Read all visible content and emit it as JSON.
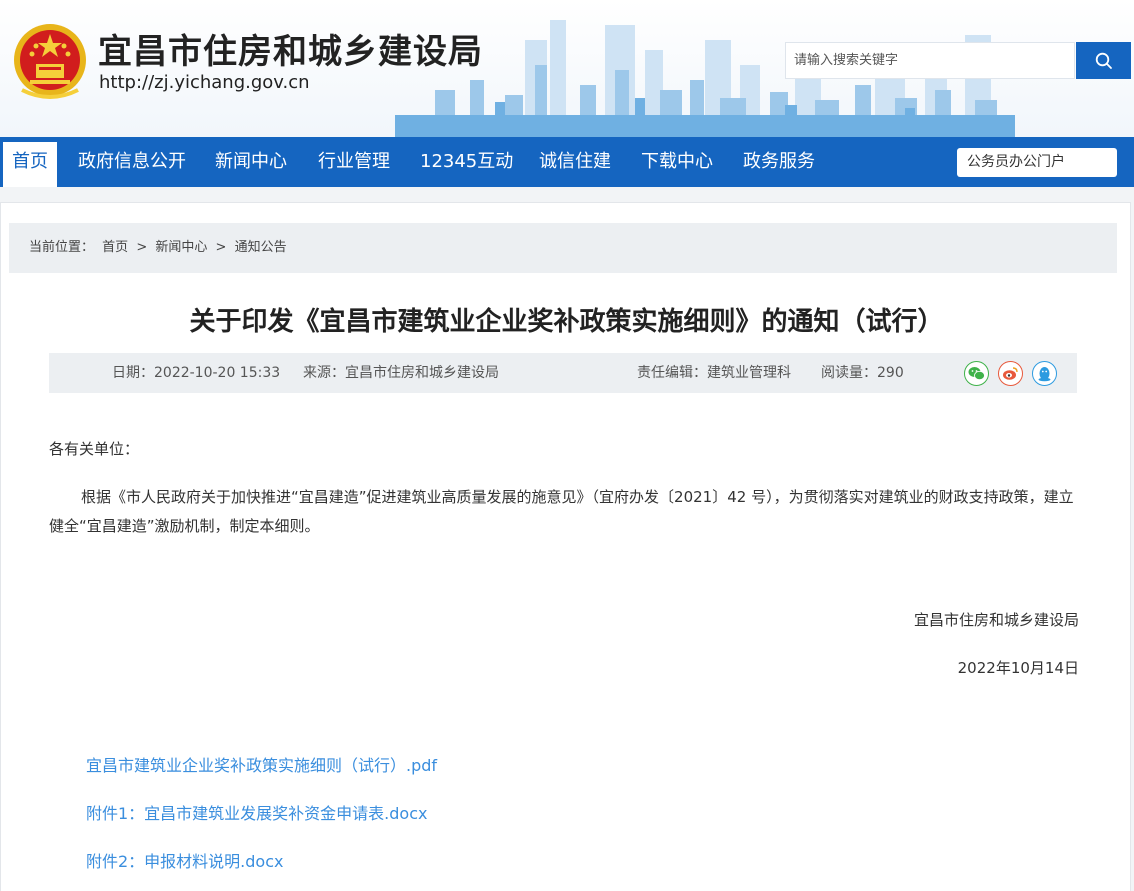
{
  "header": {
    "site_title": "宜昌市住房和城乡建设局",
    "site_url": "http://zj.yichang.gov.cn",
    "emblem_icon": "national-emblem-icon"
  },
  "search": {
    "placeholder": "请输入搜索关键字",
    "button_icon": "search-icon"
  },
  "nav": {
    "items": [
      {
        "label": "首页",
        "active": true
      },
      {
        "label": "政府信息公开"
      },
      {
        "label": "新闻中心"
      },
      {
        "label": "行业管理"
      },
      {
        "label": "12345互动"
      },
      {
        "label": "诚信住建"
      },
      {
        "label": "下载中心"
      },
      {
        "label": "政务服务"
      }
    ],
    "portal_label": "公务员办公门户"
  },
  "breadcrumb": {
    "prefix": "当前位置：",
    "items": [
      "首页",
      "新闻中心",
      "通知公告"
    ],
    "separator": ">"
  },
  "article": {
    "title": "关于印发《宜昌市建筑业企业奖补政策实施细则》的通知（试行）",
    "meta": {
      "date": "日期：2022-10-20 15:33",
      "source": "来源：宜昌市住房和城乡建设局",
      "editor": "责任编辑：建筑业管理科",
      "reads": "阅读量：290"
    },
    "share_icons": [
      "wechat-icon",
      "weibo-icon",
      "qq-icon"
    ],
    "salutation": "各有关单位：",
    "paragraph": "根据《市人民政府关于加快推进“宜昌建造”促进建筑业高质量发展的施意见》（宜府办发〔2021〕42 号），为贯彻落实对建筑业的财政支持政策，建立健全“宜昌建造”激励机制，制定本细则。",
    "signature": "宜昌市住房和城乡建设局",
    "sign_date": "2022年10月14日",
    "attachments": [
      "宜昌市建筑业企业奖补政策实施细则（试行）.pdf",
      "附件1：宜昌市建筑业发展奖补资金申请表.docx",
      "附件2：申报材料说明.docx"
    ]
  },
  "colors": {
    "brand_blue": "#1565c0",
    "link_blue": "#3a8ede",
    "wechat_green": "#3fb24a",
    "weibo_orange": "#e8593c",
    "qq_blue": "#2d9be0"
  }
}
